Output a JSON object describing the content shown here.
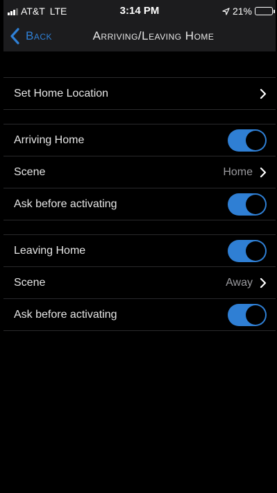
{
  "status_bar": {
    "carrier": "AT&T",
    "network": "LTE",
    "time": "3:14 PM",
    "battery_percent": "21%",
    "battery_level": 0.21
  },
  "nav": {
    "back_label": "Back",
    "title": "Arriving/Leaving Home"
  },
  "settings": {
    "set_home_location": "Set Home Location",
    "arriving": {
      "label": "Arriving Home",
      "enabled": true,
      "scene_label": "Scene",
      "scene_value": "Home",
      "ask_label": "Ask before activating",
      "ask_enabled": true
    },
    "leaving": {
      "label": "Leaving Home",
      "enabled": true,
      "scene_label": "Scene",
      "scene_value": "Away",
      "ask_label": "Ask before activating",
      "ask_enabled": true
    }
  },
  "colors": {
    "accent": "#2f7fd4",
    "background": "#000000",
    "bar_background": "#1c1c1e"
  }
}
